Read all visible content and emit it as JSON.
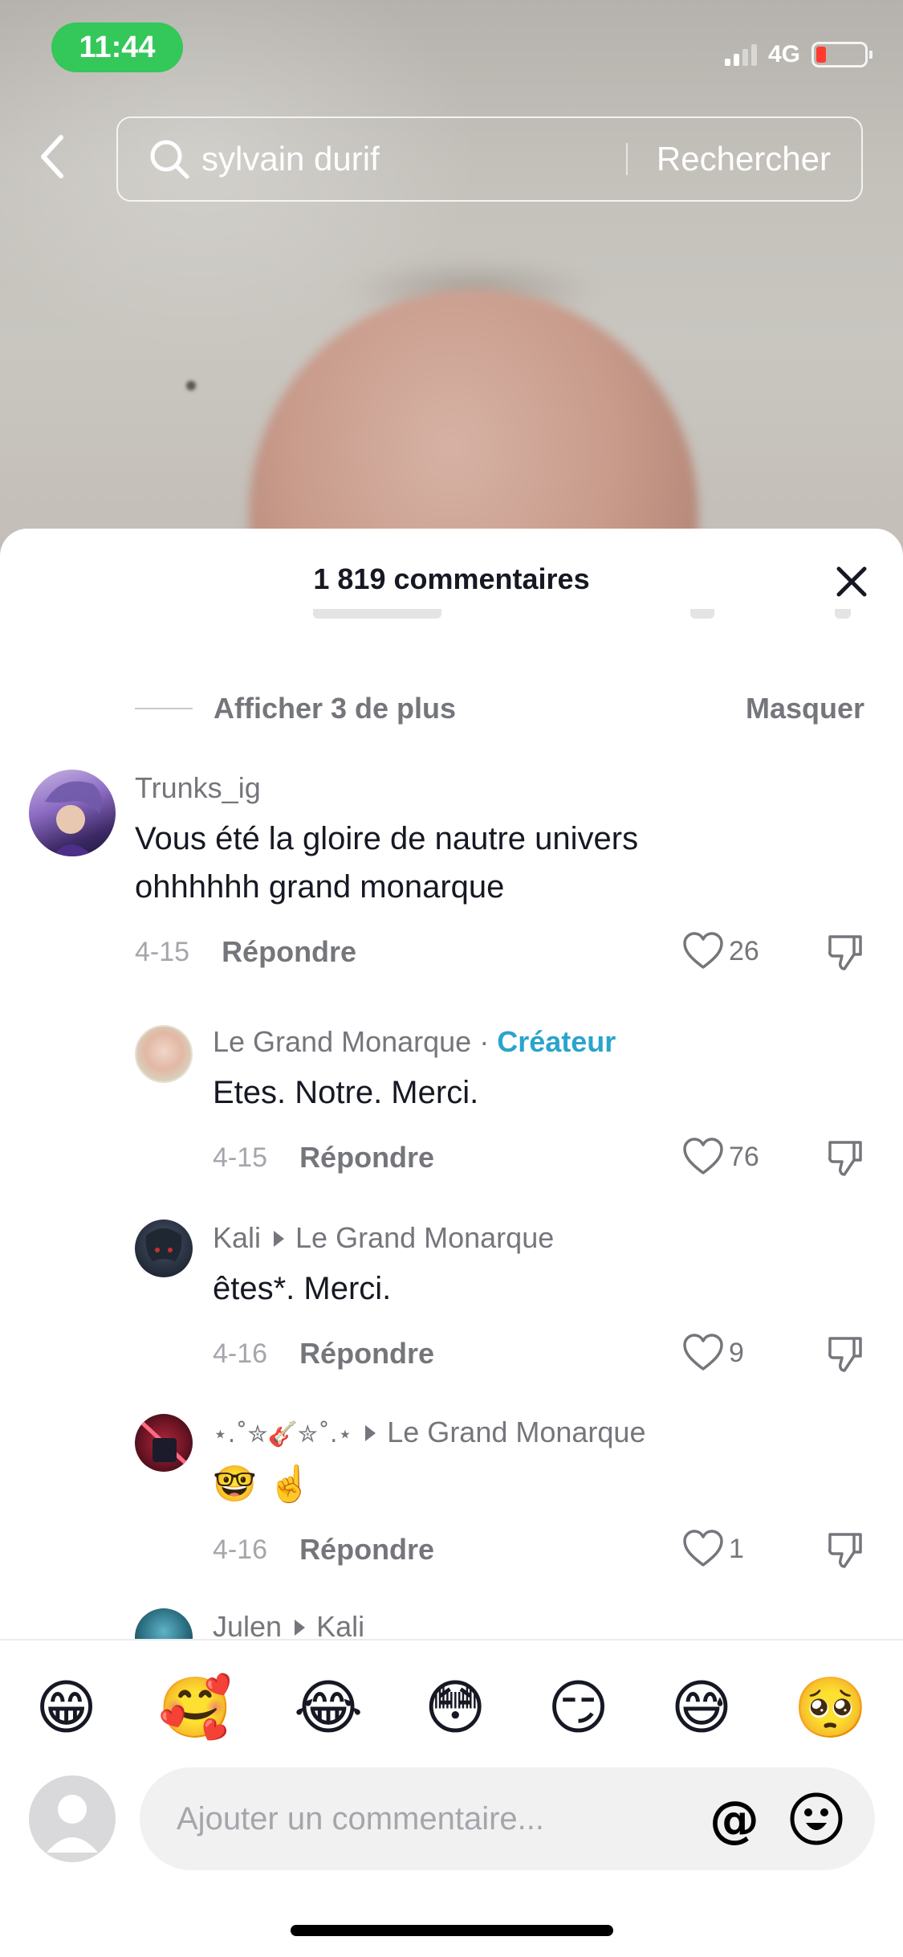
{
  "status_bar": {
    "time": "11:44",
    "network": "4G"
  },
  "search": {
    "query": "sylvain durif",
    "submit_label": "Rechercher"
  },
  "sheet": {
    "title": "1 819 commentaires",
    "show_more": "Afficher 3 de plus",
    "hide": "Masquer"
  },
  "comments": [
    {
      "author": "Trunks_ig",
      "text_line1": "Vous été la gloire de nautre univers",
      "text_line2": "ohhhhhh grand monarque",
      "date": "4-15",
      "reply": "Répondre",
      "likes": "26"
    },
    {
      "author": "Le Grand Monarque",
      "separator": "·",
      "badge": "Créateur",
      "text": "Etes. Notre. Merci.",
      "date": "4-15",
      "reply": "Répondre",
      "likes": "76"
    },
    {
      "author": "Kali",
      "reply_to": "Le Grand Monarque",
      "text": "êtes*. Merci.",
      "date": "4-16",
      "reply": "Répondre",
      "likes": "9"
    },
    {
      "author": "⋆.˚✮🎸✮˚.⋆",
      "reply_to": "Le Grand Monarque",
      "text": "🤓 ☝️",
      "date": "4-16",
      "reply": "Répondre",
      "likes": "1"
    },
    {
      "author": "Julen",
      "reply_to": "Kali"
    }
  ],
  "emoji_bar": [
    "😁",
    "🥰",
    "😂",
    "😳",
    "😏",
    "😅",
    "🥺"
  ],
  "input": {
    "placeholder": "Ajouter un commentaire...",
    "mention": "@"
  },
  "colors": {
    "creator_badge": "#2aa4cc",
    "status_pill": "#34c759",
    "battery_low": "#ff3b30"
  }
}
